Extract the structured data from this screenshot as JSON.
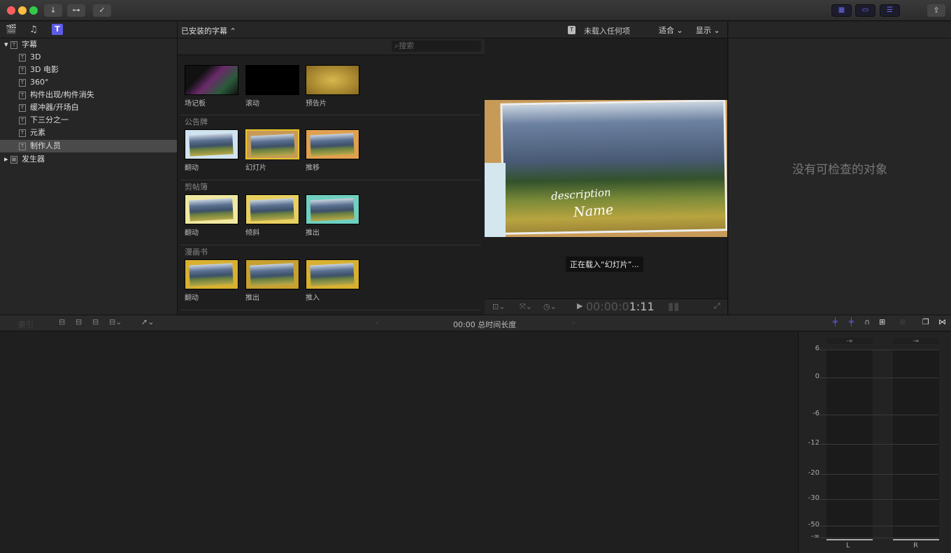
{
  "toolbar": {
    "import": "↓",
    "keywords": "⊶",
    "analyze": "✓",
    "share": "⇪"
  },
  "sidebar": {
    "items": [
      {
        "label": "字幕",
        "expanded": true
      },
      {
        "label": "3D"
      },
      {
        "label": "3D 电影"
      },
      {
        "label": "360°"
      },
      {
        "label": "构件出现/构件消失"
      },
      {
        "label": "缓冲器/开场白"
      },
      {
        "label": "下三分之一"
      },
      {
        "label": "元素"
      },
      {
        "label": "制作人员",
        "selected": true
      },
      {
        "label": "发生器",
        "expanded": false
      }
    ]
  },
  "browser": {
    "title": "已安装的字幕 ⌃",
    "search_placeholder": "搜索",
    "sections": [
      {
        "name": "",
        "items": [
          "场记板",
          "滚动",
          "预告片"
        ]
      },
      {
        "name": "公告牌",
        "items": [
          "翻动",
          "幻灯片",
          "推移"
        ]
      },
      {
        "name": "剪帖簿",
        "items": [
          "翻动",
          "倾斜",
          "推出"
        ]
      },
      {
        "name": "漫画书",
        "items": [
          "翻动",
          "推出",
          "推入"
        ]
      }
    ]
  },
  "viewer": {
    "status": "未载入任何项",
    "fit": "适合 ⌄",
    "display": "显示 ⌄",
    "overlay_desc": "description",
    "overlay_name": "Name",
    "loading": "正在载入“幻灯片”...",
    "timecode_dim": "00:00:0",
    "timecode": "1:11"
  },
  "inspector": {
    "empty": "没有可检查的对象"
  },
  "timeline": {
    "index": "索引",
    "duration": "00:00 总时间长度"
  },
  "meters": {
    "ticks": [
      "6",
      "0",
      "-6",
      "-12",
      "-20",
      "-30",
      "-50",
      "-∞"
    ],
    "peak_l": "-∞",
    "peak_r": "-∞",
    "channels": [
      "L",
      "R"
    ]
  },
  "colors": {
    "accent": "#5e5ce6",
    "selection": "#e8c428"
  }
}
